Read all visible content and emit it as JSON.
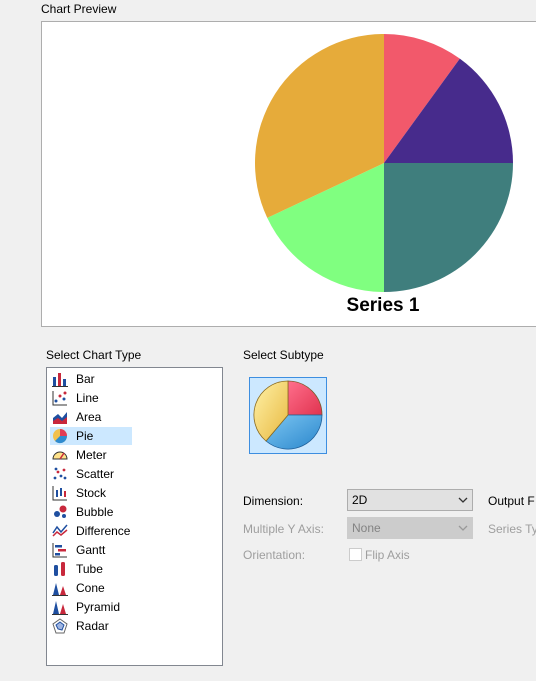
{
  "preview": {
    "heading": "Chart Preview"
  },
  "chart_data": {
    "type": "pie",
    "title": "Series 1",
    "slices": [
      {
        "value": 10,
        "color": "#f2596b"
      },
      {
        "value": 15,
        "color": "#472b8c"
      },
      {
        "value": 25,
        "color": "#3f7e7d"
      },
      {
        "value": 18,
        "color": "#80ff80"
      },
      {
        "value": 32,
        "color": "#e6ab3a"
      }
    ]
  },
  "chart_type": {
    "heading": "Select Chart Type",
    "selected": "Pie",
    "items": [
      {
        "label": "Bar",
        "icon": "bar-chart-icon"
      },
      {
        "label": "Line",
        "icon": "line-chart-icon"
      },
      {
        "label": "Area",
        "icon": "area-chart-icon"
      },
      {
        "label": "Pie",
        "icon": "pie-chart-icon"
      },
      {
        "label": "Meter",
        "icon": "meter-chart-icon"
      },
      {
        "label": "Scatter",
        "icon": "scatter-chart-icon"
      },
      {
        "label": "Stock",
        "icon": "stock-chart-icon"
      },
      {
        "label": "Bubble",
        "icon": "bubble-chart-icon"
      },
      {
        "label": "Difference",
        "icon": "difference-chart-icon"
      },
      {
        "label": "Gantt",
        "icon": "gantt-chart-icon"
      },
      {
        "label": "Tube",
        "icon": "tube-chart-icon"
      },
      {
        "label": "Cone",
        "icon": "cone-chart-icon"
      },
      {
        "label": "Pyramid",
        "icon": "pyramid-chart-icon"
      },
      {
        "label": "Radar",
        "icon": "radar-chart-icon"
      }
    ]
  },
  "subtype": {
    "heading": "Select Subtype",
    "icon": "pie-subtype-icon"
  },
  "options": {
    "dimension_label": "Dimension:",
    "dimension_value": "2D",
    "output_label": "Output F",
    "multiple_y_label": "Multiple Y Axis:",
    "multiple_y_value": "None",
    "series_type_label": "Series Typ",
    "orientation_label": "Orientation:",
    "flip_axis_label": "Flip Axis",
    "flip_axis_checked": false
  },
  "colors": {
    "selection": "#cce8ff",
    "selection_border": "#3d8ee0"
  }
}
